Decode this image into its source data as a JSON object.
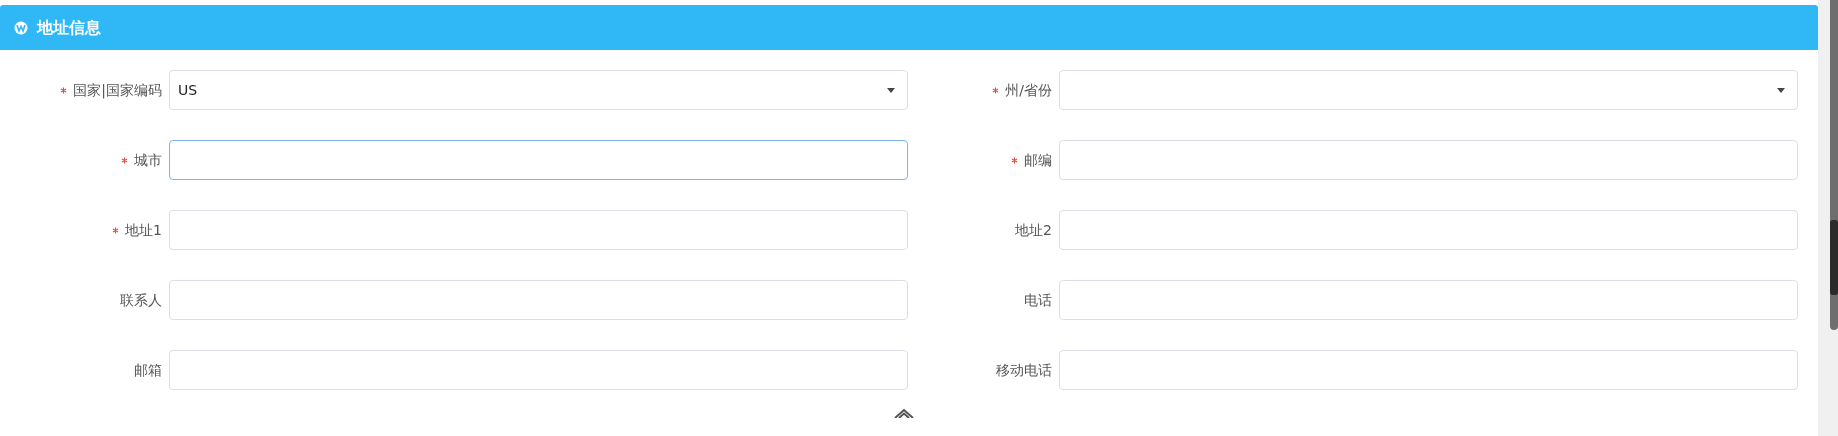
{
  "panel": {
    "title": "地址信息"
  },
  "fields": [
    {
      "label": "国家|国家编码",
      "required": true,
      "kind": "select",
      "value": "US",
      "focused": false
    },
    {
      "label": "州/省份",
      "required": true,
      "kind": "select",
      "focused": false
    },
    {
      "label": "城市",
      "required": true,
      "kind": "input",
      "focused": true
    },
    {
      "label": "邮编",
      "required": true,
      "kind": "input",
      "focused": false
    },
    {
      "label": "地址1",
      "required": true,
      "kind": "input",
      "focused": false
    },
    {
      "label": "地址2",
      "required": false,
      "kind": "input",
      "focused": false
    },
    {
      "label": "联系人",
      "required": false,
      "kind": "input",
      "focused": false
    },
    {
      "label": "电话",
      "required": false,
      "kind": "input",
      "focused": false
    },
    {
      "label": "邮箱",
      "required": false,
      "kind": "input",
      "focused": false
    },
    {
      "label": "移动电话",
      "required": false,
      "kind": "input",
      "focused": false
    }
  ]
}
